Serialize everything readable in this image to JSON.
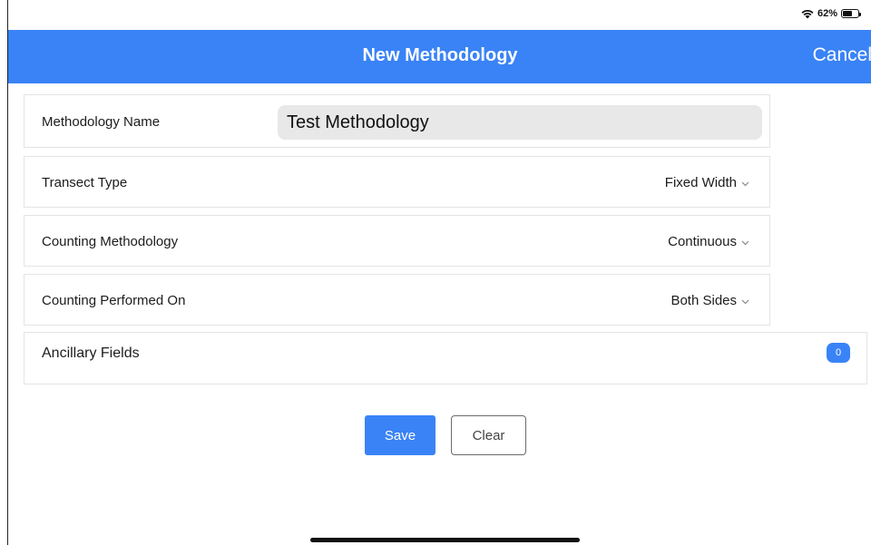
{
  "status_bar": {
    "battery_percent": "62%",
    "battery_level": 0.62,
    "wifi_icon": "wifi-icon",
    "battery_icon": "battery-icon"
  },
  "nav": {
    "title": "New Methodology",
    "cancel_label": "Cancel"
  },
  "form": {
    "methodology_name": {
      "label": "Methodology Name",
      "value": "Test Methodology"
    },
    "transect_type": {
      "label": "Transect Type",
      "value": "Fixed Width"
    },
    "counting_methodology": {
      "label": "Counting Methodology",
      "value": "Continuous"
    },
    "counting_performed_on": {
      "label": "Counting Performed On",
      "value": "Both Sides"
    },
    "ancillary_fields": {
      "label": "Ancillary Fields",
      "count": "0"
    }
  },
  "buttons": {
    "save_label": "Save",
    "clear_label": "Clear"
  },
  "colors": {
    "accent": "#3a83f6",
    "background": "#ffffff",
    "input_fill": "#e8e8e9"
  }
}
